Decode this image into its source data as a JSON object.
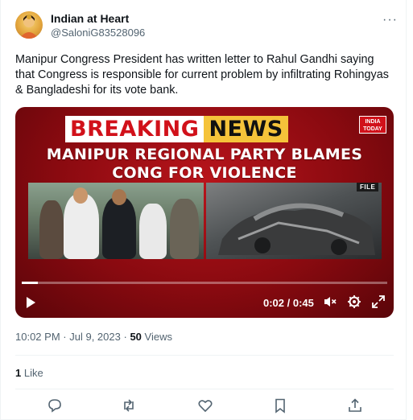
{
  "author": {
    "name": "Indian at Heart",
    "handle": "@SaloniG83528096"
  },
  "tweet": {
    "text": "Manipur Congress President has written letter to Rahul Gandhi saying that Congress is responsible for current problem by infiltrating Rohingyas & Bangladeshi for its vote bank."
  },
  "video": {
    "banner_left": "BREAKING",
    "banner_right": "NEWS",
    "channel_logo": "INDIA TODAY",
    "headline_line1": "MANIPUR REGIONAL PARTY BLAMES",
    "headline_line2": "CONG FOR VIOLENCE",
    "file_tag": "FILE",
    "time_display": "0:02 / 0:45",
    "progress_fraction": 0.044,
    "icons": [
      "play-icon",
      "mute-icon",
      "settings-icon",
      "fullscreen-icon"
    ],
    "colors": {
      "banner_red": "#d1111a",
      "banner_yellow": "#f5c33a"
    }
  },
  "meta": {
    "time": "10:02 PM",
    "sep1": "·",
    "date": "Jul 9, 2023",
    "sep2": "·",
    "views_count": "50",
    "views_label": "Views"
  },
  "engagement": {
    "likes_count": "1",
    "likes_label": "Like"
  },
  "actions": [
    "reply-icon",
    "retweet-icon",
    "like-icon",
    "bookmark-icon",
    "share-icon"
  ],
  "colors": {
    "text_primary": "#0f1419",
    "text_secondary": "#536471",
    "border": "#eff3f4"
  }
}
